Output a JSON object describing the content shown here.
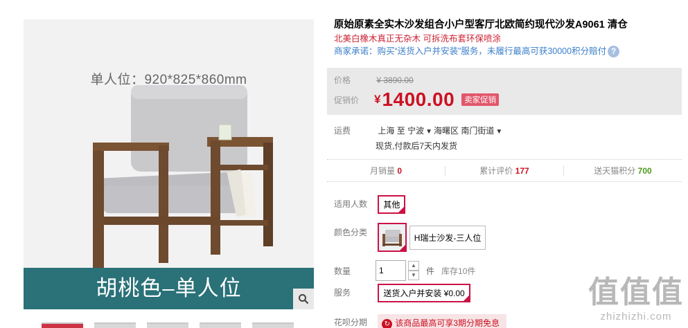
{
  "gallery": {
    "dimension_text": "单人位：920*825*860mm",
    "color_banner": "胡桃色–单人位",
    "zoom_icon": "search-icon",
    "thumbnails": [
      "thumb-1",
      "thumb-2",
      "thumb-3",
      "thumb-4",
      "thumb-5"
    ]
  },
  "product": {
    "title": "原始原素全实木沙发组合小户型客厅北欧简约现代沙发A9061 清仓",
    "subtitle": "北美白橡木真正无杂木 可拆洗布套环保喷涂",
    "promise": "商家承诺：购买“送货入户并安装”服务，未履行最高可获30000积分赔付",
    "help_icon": "?"
  },
  "price": {
    "original_label": "价格",
    "original_value": "¥ 3890.00",
    "promo_label": "促销价",
    "currency": "¥",
    "promo_value": "1400.00",
    "promo_badge": "卖家促销"
  },
  "shipping": {
    "label": "运费",
    "from": "上海",
    "to_word": "至",
    "city": "宁波",
    "district": "海曙区",
    "street": "南门街道",
    "note": "现货,付款后7天内发货"
  },
  "stats": [
    {
      "label": "月销量",
      "value": "0"
    },
    {
      "label": "累计评价",
      "value": "177"
    },
    {
      "label": "送天猫积分",
      "value": "700"
    }
  ],
  "options": {
    "audience_label": "适用人数",
    "audience_value": "其他",
    "color_label": "颜色分类",
    "color_value": "H瑞士沙发-三人位",
    "qty_label": "数量",
    "qty_value": "1",
    "qty_up": "▲",
    "qty_down": "▼",
    "qty_unit": "件",
    "stock": "库存10件",
    "service_label": "服务",
    "service_value": "送货入户并安装 ¥0.00",
    "installment_label": "花呗分期",
    "installment_value": "该商品最高可享3期分期免息"
  },
  "watermark": {
    "logo": "值值值",
    "url": "zhizhizhi.com"
  },
  "colors": {
    "accent_red": "#cc1122",
    "banner_teal": "#2a7178",
    "link_blue": "#3a7ec9"
  }
}
